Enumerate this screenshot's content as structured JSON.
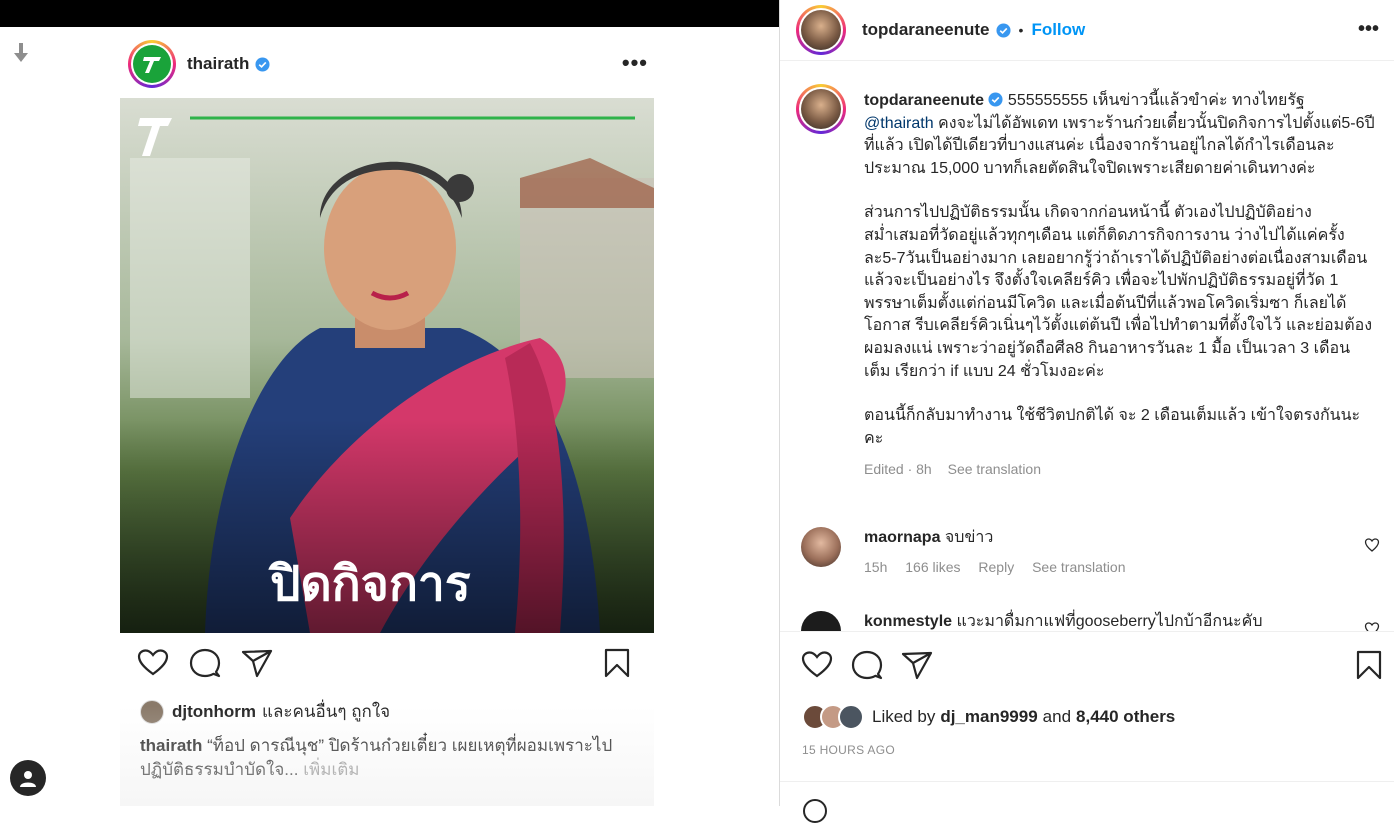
{
  "feed": {
    "post_author": "thairath",
    "image_overlay_text": "ปิดกิจการ",
    "likes_user": "djtonhorm",
    "likes_suffix": "และคนอื่นๆ ถูกใจ",
    "caption_user": "thairath",
    "caption_text": "“ท็อป ดารณีนุช” ปิดร้านก๋วยเตี๋ยว เผยเหตุที่ผอมเพราะไปปฏิบัติธรรมบำบัดใจ...",
    "caption_more": "เพิ่มเติม"
  },
  "detail": {
    "author": "topdaraneenute",
    "follow_label": "Follow",
    "caption_p1_start": "555555555 เห็นข่าวนี้แล้วขำค่ะ ทางไทยรัฐ",
    "caption_mention": "@thairath",
    "caption_p1_end": " คงจะไม่ได้อัพเดท เพราะร้านก๋วยเตี๋ยวนั้นปิดกิจการไปตั้งแต่5-6ปีที่แล้ว เปิดได้ปีเดียวที่บางแสนค่ะ เนื่องจากร้านอยู่ไกลได้กำไรเดือนละประมาณ 15,000 บาทก็เลยตัดสินใจปิดเพราะเสียดายค่าเดินทางค่ะ",
    "caption_p2": "ส่วนการไปปฏิบัติธรรมนั้น เกิดจากก่อนหน้านี้ ตัวเองไปปฏิบัติอย่างสม่ำเสมอที่วัดอยู่แล้วทุกๆเดือน แต่ก็ติดภารกิจการงาน ว่างไปได้แค่ครั้งละ5-7วันเป็นอย่างมาก เลยอยากรู้ว่าถ้าเราได้ปฏิบัติอย่างต่อเนื่องสามเดือนแล้วจะเป็นอย่างไร จึงตั้งใจเคลียร์คิว เพื่อจะไปพักปฏิบัติธรรมอยู่ที่วัด 1 พรรษาเต็มตั้งแต่ก่อนมีโควิด และเมื่อต้นปีที่แล้วพอโควิดเริ่มซา ก็เลยได้โอกาส รีบเคลียร์คิวเนิ่นๆไว้ตั้งแต่ต้นปี เพื่อไปทำตามที่ตั้งใจไว้ และย่อมต้องผอมลงแน่ เพราะว่าอยู่วัดถือศีล8 กินอาหารวันละ 1 มื้อ เป็นเวลา 3 เดือนเต็ม เรียกว่า if แบบ 24 ชั่วโมงอะค่ะ",
    "caption_p3": "ตอนนี้ก็กลับมาทำงาน ใช้ชีวิตปกติได้ จะ 2 เดือนเต็มแล้ว เข้าใจตรงกันนะคะ",
    "caption_edited": "Edited · 8h",
    "see_translation": "See translation",
    "comments": [
      {
        "user": "maornapa",
        "text": "จบข่าว",
        "age": "15h",
        "likes": "166 likes",
        "reply": "Reply",
        "translate": "See translation"
      },
      {
        "user": "konmestyle",
        "text": "แวะมาดื่มกาแฟที่gooseberryไปกบ้าอีกนะคับ",
        "age": "",
        "likes": "",
        "reply": "",
        "translate": ""
      }
    ],
    "liked_prefix": "Liked by",
    "liked_user": "dj_man9999",
    "liked_and": "and",
    "liked_others": "8,440 others",
    "posted_ago": "15 HOURS AGO"
  },
  "colors": {
    "follow_blue": "#0095f6",
    "verified_blue": "#3897f0",
    "thairath_green": "#1aa33a",
    "mention": "#00376b",
    "secondary_text": "#8e8e8e"
  }
}
